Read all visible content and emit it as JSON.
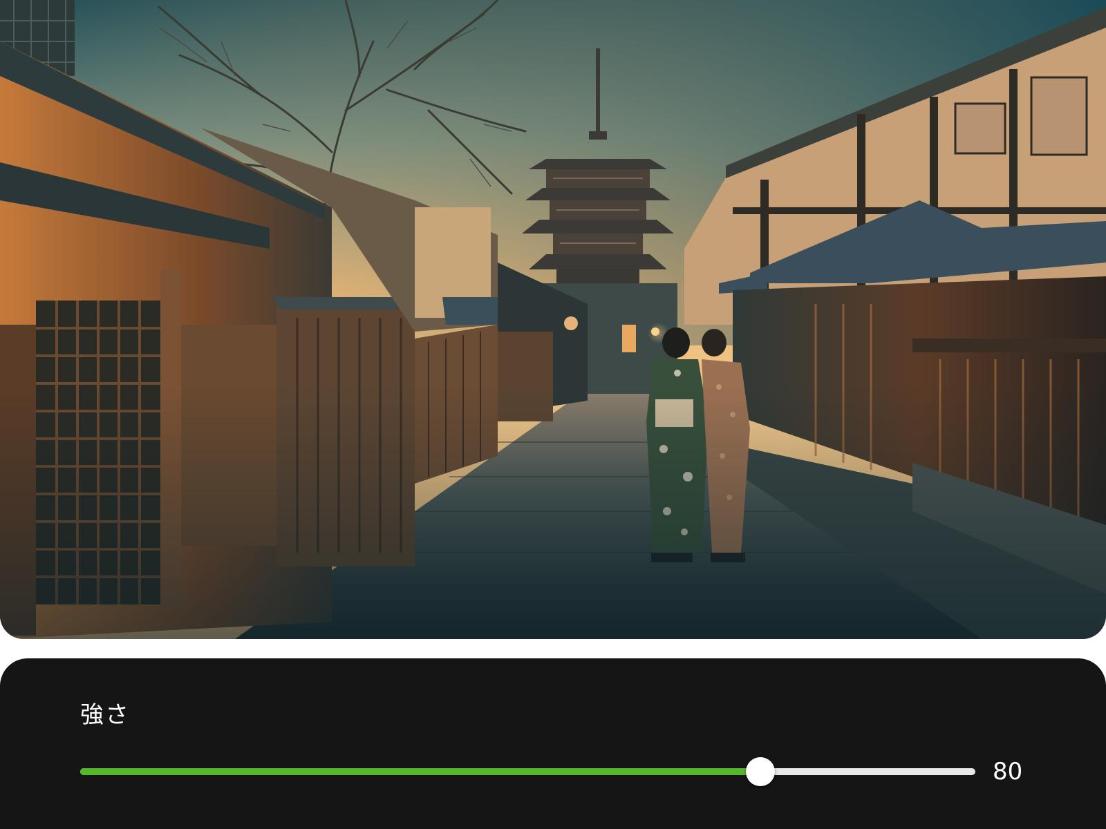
{
  "image": {
    "description_icon": "photo-kyoto-street-icon"
  },
  "strength": {
    "label": "強さ",
    "value": 80,
    "value_text": "80",
    "fraction": 0.76,
    "fill_color": "#55b828",
    "track_color": "#e9e9e9"
  }
}
